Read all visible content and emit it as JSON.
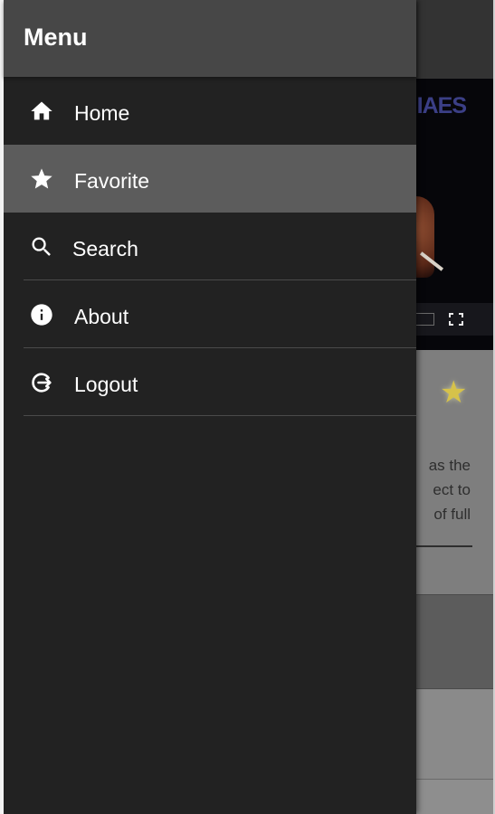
{
  "drawer": {
    "title": "Menu",
    "items": [
      {
        "label": "Home",
        "icon": "home-icon",
        "active": false
      },
      {
        "label": "Favorite",
        "icon": "star-icon",
        "active": true
      },
      {
        "label": "Search",
        "icon": "search-icon",
        "active": false
      },
      {
        "label": "About",
        "icon": "info-icon",
        "active": false
      },
      {
        "label": "Logout",
        "icon": "logout-icon",
        "active": false
      }
    ]
  },
  "background": {
    "video_title_fragment": "IAES",
    "description_fragments": [
      "as  the",
      "ect to",
      "of full"
    ]
  },
  "colors": {
    "drawer_bg": "#222222",
    "drawer_header_bg": "#474747",
    "active_item_bg": "#5c5c5c",
    "text": "#ffffff",
    "favorite_star": "#d6c24a"
  }
}
